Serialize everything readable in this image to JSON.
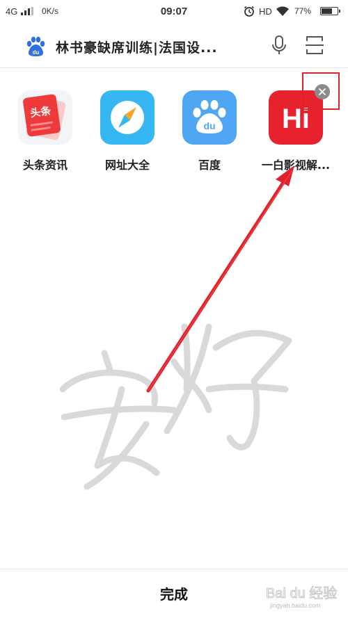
{
  "status_bar": {
    "network": "4G",
    "speed": "0K/s",
    "time": "09:07",
    "hd": "HD",
    "battery": "77%",
    "battery_level": 0.77
  },
  "search": {
    "title": "林书豪缺席训练|法国设..."
  },
  "apps": [
    {
      "label": "头条资讯",
      "icon": "toutiao-news-icon",
      "tile_text": "头条",
      "color": "#ee3a3a"
    },
    {
      "label": "网址大全",
      "icon": "compass-icon",
      "color": "#36b6f2"
    },
    {
      "label": "百度",
      "icon": "baidu-paw-icon",
      "tile_text": "du",
      "color": "#4fa6f3"
    },
    {
      "label": "一白影视解...",
      "icon": "hi-video-icon",
      "tile_text": "Hi",
      "color": "#e8212e"
    }
  ],
  "annotation": {
    "handwriting": "安好",
    "arrow_color": "#e0202a"
  },
  "bottom": {
    "done_label": "完成"
  },
  "watermark": {
    "brand": "Bai du 经验",
    "url": "jingyan.baidu.com"
  }
}
